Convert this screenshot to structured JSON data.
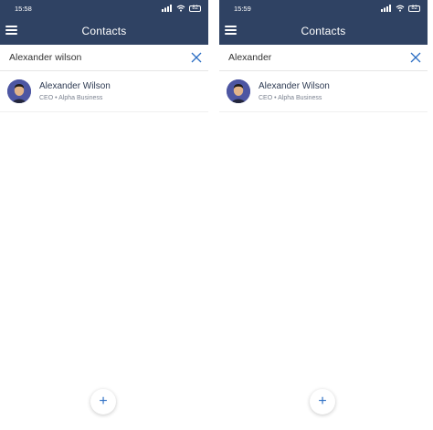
{
  "colors": {
    "header_bg": "#2f4263",
    "accent": "#2d6fc4",
    "avatar_bg": "#4d56a2"
  },
  "screens": [
    {
      "status": {
        "time": "15:58",
        "battery": "82"
      },
      "header": {
        "title": "Contacts"
      },
      "search": {
        "value": "Alexander wilson"
      },
      "contacts": [
        {
          "name": "Alexander Wilson",
          "meta": "CEO • Alpha Business"
        }
      ],
      "fab_label": "+"
    },
    {
      "status": {
        "time": "15:59",
        "battery": "82"
      },
      "header": {
        "title": "Contacts"
      },
      "search": {
        "value": "Alexander"
      },
      "contacts": [
        {
          "name": "Alexander Wilson",
          "meta": "CEO • Alpha Business"
        }
      ],
      "fab_label": "+"
    }
  ],
  "icons": [
    "menu-icon",
    "close-icon",
    "signal-icon",
    "wifi-icon",
    "battery-icon",
    "plus-icon"
  ]
}
